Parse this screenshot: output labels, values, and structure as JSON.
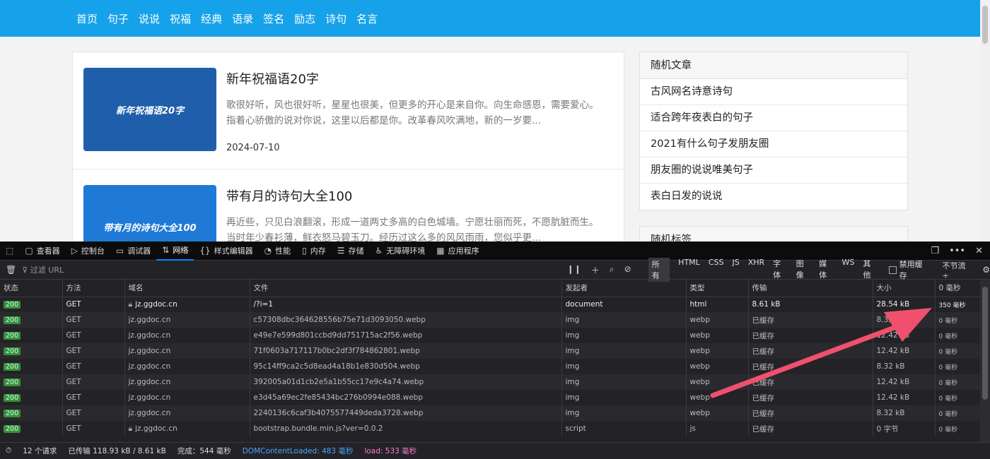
{
  "site": {
    "nav": [
      "首页",
      "句子",
      "说说",
      "祝福",
      "经典",
      "语录",
      "签名",
      "励志",
      "诗句",
      "名言"
    ],
    "posts": [
      {
        "thumb": "新年祝福语20字",
        "title": "新年祝福语20字",
        "desc": "歌很好听，风也很好听，星星也很美，但更多的开心是来自你。向生命感恩，需要爱心。指着心骄傲的说对你说，这里以后都是你。改革春风吹满地，新的一岁要...",
        "date": "2024-07-10"
      },
      {
        "thumb": "带有月的诗句大全100",
        "title": "带有月的诗句大全100",
        "desc": "再近些，只见白浪翻滚，形成一道两丈多高的白色城墙。宁愿壮丽而死，不愿肮脏而生。当时年少春衫薄，鲜衣怒马碧玉刀。经历过这么多的风风雨雨，您似乎更...",
        "date": ""
      }
    ],
    "sidebar": {
      "title": "随机文章",
      "items": [
        "古风网名诗意诗句",
        "适合跨年夜表白的句子",
        "2021有什么句子发朋友圈",
        "朋友圈的说说唯美句子",
        "表白日发的说说"
      ],
      "title2": "随机标签"
    }
  },
  "devtools": {
    "tabs": [
      {
        "label": "查看器",
        "icon": "inspector-icon"
      },
      {
        "label": "控制台",
        "icon": "console-icon"
      },
      {
        "label": "调试器",
        "icon": "debugger-icon"
      },
      {
        "label": "网络",
        "icon": "network-icon"
      },
      {
        "label": "样式编辑器",
        "icon": "style-editor-icon"
      },
      {
        "label": "性能",
        "icon": "performance-icon"
      },
      {
        "label": "内存",
        "icon": "memory-icon"
      },
      {
        "label": "存储",
        "icon": "storage-icon"
      },
      {
        "label": "无障碍环境",
        "icon": "accessibility-icon"
      },
      {
        "label": "应用程序",
        "icon": "application-icon"
      }
    ],
    "active_tab": "网络",
    "filter_placeholder": "过滤 URL",
    "types": [
      "所有",
      "HTML",
      "CSS",
      "JS",
      "XHR",
      "字体",
      "图像",
      "媒体",
      "WS",
      "其他"
    ],
    "disable_cache": "禁用缓存",
    "throttle": "不节流 ÷",
    "columns": [
      "状态",
      "方法",
      "域名",
      "文件",
      "发起者",
      "类型",
      "传输",
      "大小",
      "0 毫秒"
    ],
    "rows": [
      {
        "status": "200",
        "method": "GET",
        "domain": "jz.ggdoc.cn",
        "lock": true,
        "file": "/?i=1",
        "initiator": "document",
        "type": "html",
        "transfer": "8.61 kB",
        "size": "28.54 kB",
        "time": "350 毫秒"
      },
      {
        "status": "200",
        "method": "GET",
        "domain": "jz.ggdoc.cn",
        "lock": false,
        "file": "c57308dbc364628556b75e71d3093050.webp",
        "initiator": "img",
        "type": "webp",
        "transfer": "已缓存",
        "size": "8.32 kB",
        "time": "0 毫秒"
      },
      {
        "status": "200",
        "method": "GET",
        "domain": "jz.ggdoc.cn",
        "lock": false,
        "file": "e49e7e599d801ccbd9dd751715ac2f56.webp",
        "initiator": "img",
        "type": "webp",
        "transfer": "已缓存",
        "size": "12.42 kB",
        "time": "0 毫秒"
      },
      {
        "status": "200",
        "method": "GET",
        "domain": "jz.ggdoc.cn",
        "lock": false,
        "file": "71f0603a717117b0bc2df3f784862801.webp",
        "initiator": "img",
        "type": "webp",
        "transfer": "已缓存",
        "size": "12.42 kB",
        "time": "0 毫秒"
      },
      {
        "status": "200",
        "method": "GET",
        "domain": "jz.ggdoc.cn",
        "lock": false,
        "file": "95c14ff9ca2c5d8ead4a18b1e830d504.webp",
        "initiator": "img",
        "type": "webp",
        "transfer": "已缓存",
        "size": "8.32 kB",
        "time": "0 毫秒"
      },
      {
        "status": "200",
        "method": "GET",
        "domain": "jz.ggdoc.cn",
        "lock": false,
        "file": "392005a01d1cb2e5a1b55cc17e9c4a74.webp",
        "initiator": "img",
        "type": "webp",
        "transfer": "已缓存",
        "size": "12.42 kB",
        "time": "0 毫秒"
      },
      {
        "status": "200",
        "method": "GET",
        "domain": "jz.ggdoc.cn",
        "lock": false,
        "file": "e3d45a69ec2fe85434bc276b0994e088.webp",
        "initiator": "img",
        "type": "webp",
        "transfer": "已缓存",
        "size": "12.42 kB",
        "time": "0 毫秒"
      },
      {
        "status": "200",
        "method": "GET",
        "domain": "jz.ggdoc.cn",
        "lock": false,
        "file": "2240136c6caf3b4075577449deda3728.webp",
        "initiator": "img",
        "type": "webp",
        "transfer": "已缓存",
        "size": "8.32 kB",
        "time": "0 毫秒"
      },
      {
        "status": "200",
        "method": "GET",
        "domain": "jz.ggdoc.cn",
        "lock": true,
        "file": "bootstrap.bundle.min.js?ver=0.0.2",
        "initiator": "script",
        "type": "js",
        "transfer": "已缓存",
        "size": "0 字节",
        "time": "0 毫秒"
      }
    ],
    "status_bar": {
      "requests": "12 个请求",
      "transferred": "已传输 118.93 kB / 8.61 kB",
      "finish": "完成：544 毫秒",
      "dcl": "DOMContentLoaded: 483 毫秒",
      "load": "load: 533 毫秒"
    }
  },
  "colors": {
    "nav": "#16a2ea",
    "annotation_arrow": "#f0506e"
  }
}
